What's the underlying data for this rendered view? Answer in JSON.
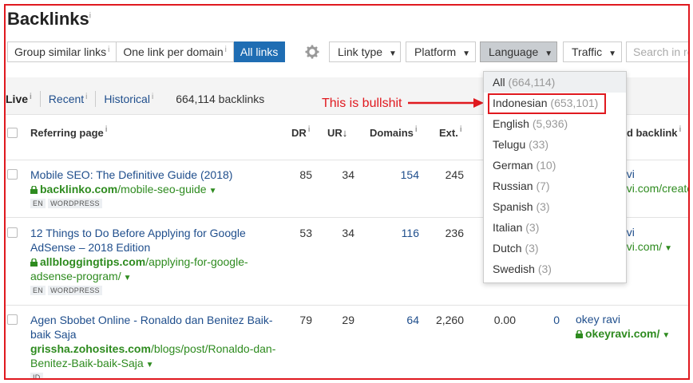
{
  "page": {
    "title": "Backlinks",
    "title_info": "i"
  },
  "toolbar": {
    "mode_buttons": [
      {
        "label": "Group similar links",
        "info": "i",
        "active": false
      },
      {
        "label": "One link per domain",
        "info": "i",
        "active": false
      },
      {
        "label": "All links",
        "active": true
      }
    ],
    "settings_icon": "gear-icon",
    "filters": [
      {
        "label": "Link type",
        "open": false
      },
      {
        "label": "Platform",
        "open": false
      },
      {
        "label": "Language",
        "open": true
      },
      {
        "label": "Traffic",
        "open": false
      }
    ],
    "search_placeholder": "Search in re"
  },
  "tabs": {
    "items": [
      {
        "label": "Live",
        "info": "i",
        "active": true
      },
      {
        "label": "Recent",
        "info": "i",
        "active": false
      },
      {
        "label": "Historical",
        "info": "i",
        "active": false
      }
    ],
    "count_label": "664,114 backlinks"
  },
  "annotation": {
    "text": "This is bullshit",
    "color": "#e0191f"
  },
  "table": {
    "headers": {
      "referring_page": "Referring page",
      "dr": "DR",
      "ur": "UR",
      "ur_sort": "↓",
      "domains": "Domains",
      "ext": "Ext.",
      "anchor": "nd backlink"
    },
    "rows": [
      {
        "title": "Mobile SEO: The Definitive Guide (2018)",
        "url_domain": "backlinko.com",
        "url_path": "/mobile-seo-guide",
        "badges": [
          "EN",
          "WORDPRESS"
        ],
        "dr": "85",
        "ur": "34",
        "domains": "154",
        "ext": "245",
        "anchor_text": "avi",
        "anchor_url": "avi.com/create-"
      },
      {
        "title": "12 Things to Do Before Applying for Google AdSense – 2018 Edition",
        "url_domain": "allbloggingtips.com",
        "url_path": "/applying-for-google-adsense-program/",
        "badges": [
          "EN",
          "WORDPRESS"
        ],
        "dr": "53",
        "ur": "34",
        "domains": "116",
        "ext": "236",
        "anchor_text": "avi",
        "anchor_url": "avi.com/"
      },
      {
        "title": "Agen Sbobet Online - Ronaldo dan Benitez Baik-baik Saja",
        "url_domain": "grissha.zohosites.com",
        "url_path": "/blogs/post/Ronaldo-dan-Benitez-Baik-baik-Saja",
        "badges": [
          "ID"
        ],
        "dr": "79",
        "ur": "29",
        "domains": "64",
        "ext": "2,260",
        "extra1": "0.00",
        "extra2": "0",
        "anchor_text": "okey ravi",
        "anchor_url": "okeyravi.com/"
      }
    ]
  },
  "language_menu": {
    "items": [
      {
        "label": "All",
        "count": "(664,114)"
      },
      {
        "label": "Indonesian",
        "count": "(653,101)"
      },
      {
        "label": "English",
        "count": "(5,936)"
      },
      {
        "label": "Telugu",
        "count": "(33)"
      },
      {
        "label": "German",
        "count": "(10)"
      },
      {
        "label": "Russian",
        "count": "(7)"
      },
      {
        "label": "Spanish",
        "count": "(3)"
      },
      {
        "label": "Italian",
        "count": "(3)"
      },
      {
        "label": "Dutch",
        "count": "(3)"
      },
      {
        "label": "Swedish",
        "count": "(3)"
      }
    ]
  },
  "colors": {
    "accent": "#1f6db3",
    "link": "#1f4e8c",
    "url_green": "#2e8b1f",
    "annotation_red": "#e0191f"
  }
}
